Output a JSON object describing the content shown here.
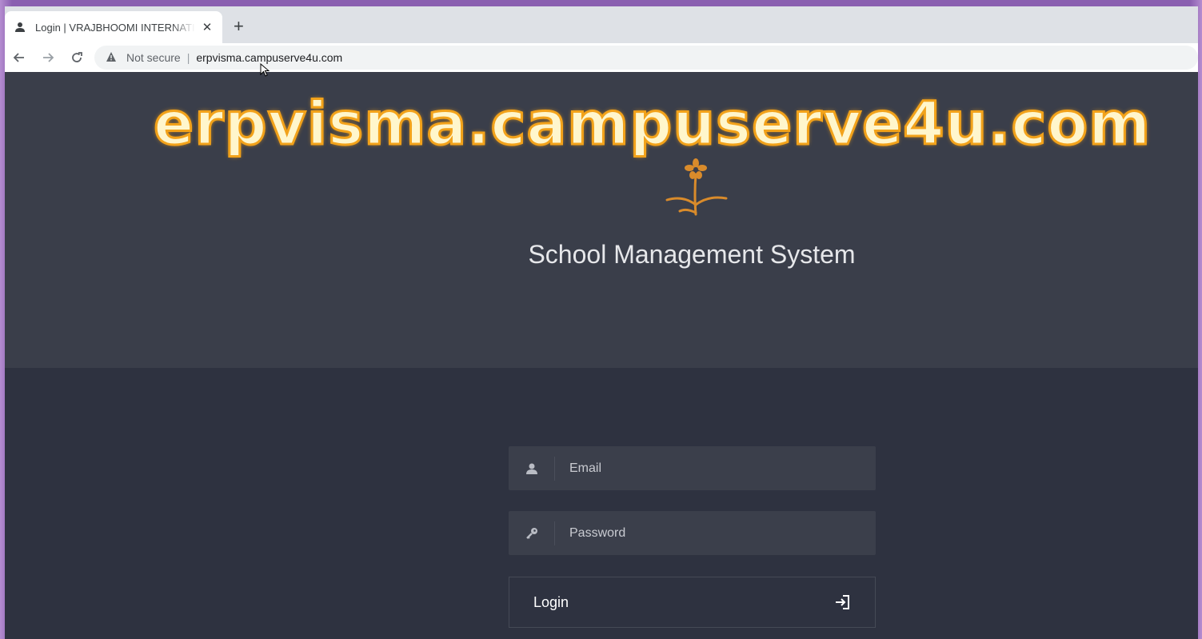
{
  "browser": {
    "tab_title": "Login | VRAJBHOOMI INTERNATIONAL",
    "tab_close": "✕",
    "new_tab": "+",
    "security_label": "Not secure",
    "separator": "|",
    "url": "erpvisma.campuserve4u.com"
  },
  "overlay": {
    "watermark_text": "erpvisma.campuserve4u.com"
  },
  "page": {
    "app_title": "School Management System",
    "email_placeholder": "Email",
    "password_placeholder": "Password",
    "login_label": "Login"
  },
  "colors": {
    "hero_bg": "#3a3e4a",
    "lower_bg": "#2e3240",
    "logo_accent": "#d98b2b",
    "watermark_fill": "#fff6cc",
    "watermark_stroke": "#f2a21a"
  },
  "icons": {
    "tab_favicon": "user-icon",
    "back": "arrow-left-icon",
    "forward": "arrow-right-icon",
    "reload": "reload-icon",
    "security": "warning-icon",
    "email_field": "user-icon",
    "password_field": "key-icon",
    "login": "sign-in-icon",
    "logo": "flower-logo"
  }
}
